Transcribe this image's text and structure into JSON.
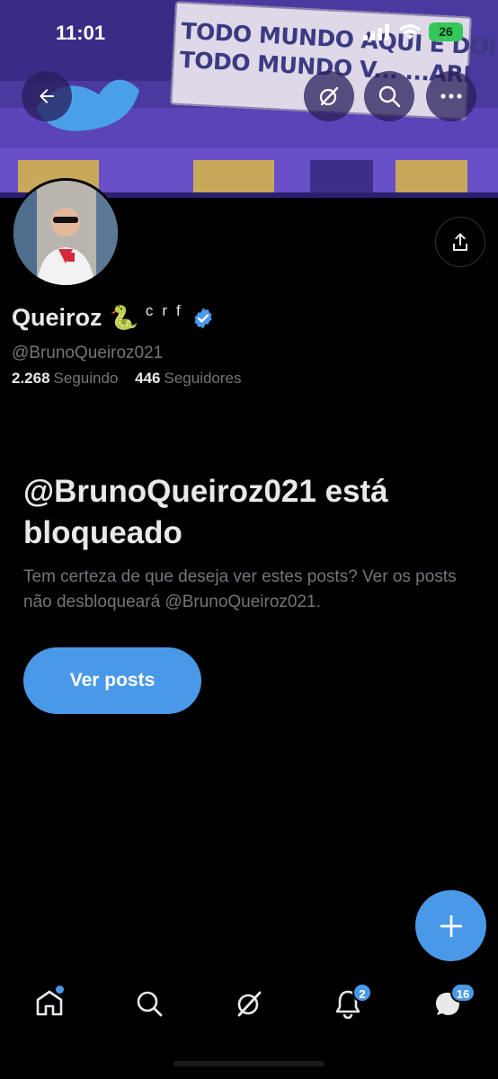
{
  "status_bar": {
    "time": "11:01",
    "battery": "26"
  },
  "banner": {
    "sign_line1": "TODO MUNDO AQUI É DOIDO",
    "sign_line2": "TODO MUNDO V... ...ARI"
  },
  "profile": {
    "name": "Queiroz",
    "emoji": "🐍",
    "suffix": "crf",
    "handle": "@BrunoQueiroz021",
    "following_count": "2.268",
    "following_label": "Seguindo",
    "followers_count": "446",
    "followers_label": "Seguidores"
  },
  "blocked": {
    "title": "@BrunoQueiroz021 está bloqueado",
    "description": "Tem certeza de que deseja ver estes posts? Ver os posts não desbloqueará @BrunoQueiroz021.",
    "button": "Ver posts"
  },
  "tabbar": {
    "notifications_badge": "2",
    "messages_badge": "16"
  },
  "colors": {
    "accent": "#4a99e9",
    "background": "#000000",
    "muted_text": "#71767b",
    "primary_text": "#e7e9ea"
  }
}
